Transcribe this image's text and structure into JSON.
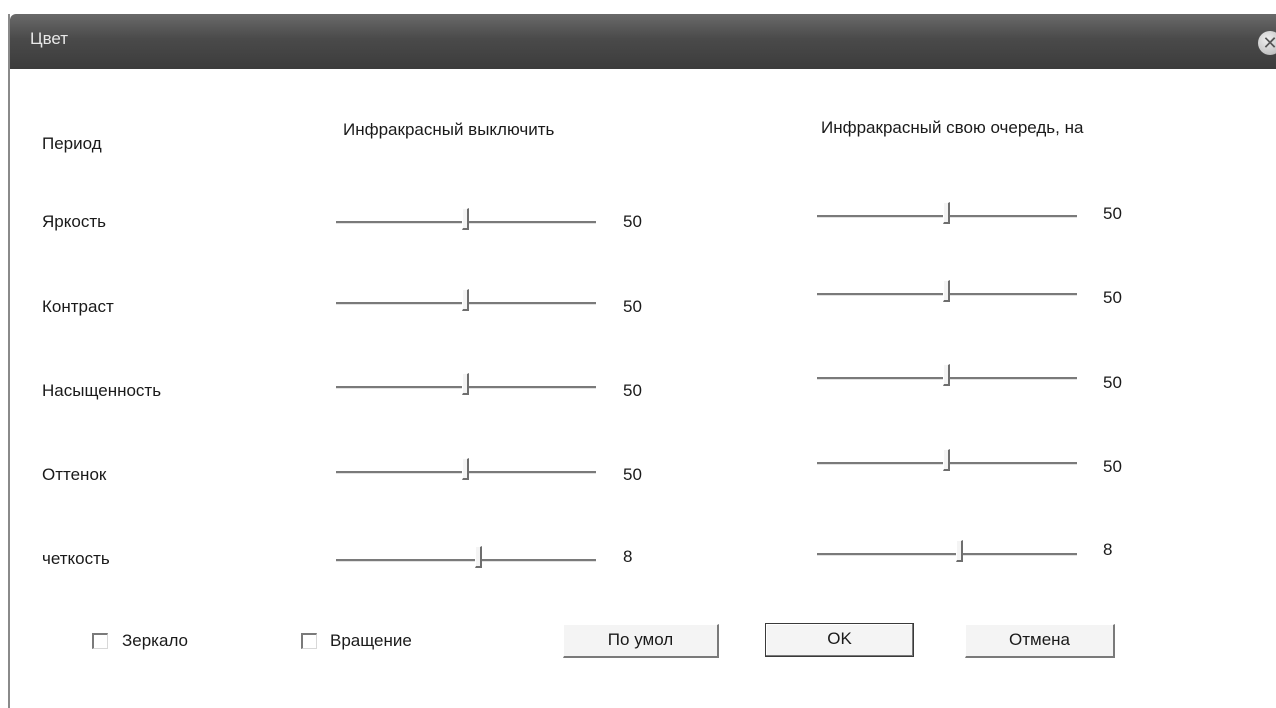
{
  "window": {
    "title": "Цвет"
  },
  "headers": {
    "period": "Период",
    "ir_off": "Инфракрасный выключить",
    "ir_on": "Инфракрасный свою очередь, на"
  },
  "rows": [
    {
      "label": "Яркость",
      "ir_off": 50,
      "ir_on": 50
    },
    {
      "label": "Контраст",
      "ir_off": 50,
      "ir_on": 50
    },
    {
      "label": "Насыщенность",
      "ir_off": 50,
      "ir_on": 50
    },
    {
      "label": "Оттенок",
      "ir_off": 50,
      "ir_on": 50
    },
    {
      "label": "четкость",
      "ir_off": 8,
      "ir_on": 8
    }
  ],
  "slider_fraction": {
    "Яркость": 0.5,
    "Контраст": 0.5,
    "Насыщенность": 0.5,
    "Оттенок": 0.5,
    "четкость": 0.55
  },
  "checkboxes": {
    "mirror": "Зеркало",
    "rotate": "Вращение",
    "mirror_checked": false,
    "rotate_checked": false
  },
  "buttons": {
    "default": "По умол",
    "ok": "OK",
    "cancel": "Отмена"
  },
  "icons": {
    "close": "close-icon"
  }
}
